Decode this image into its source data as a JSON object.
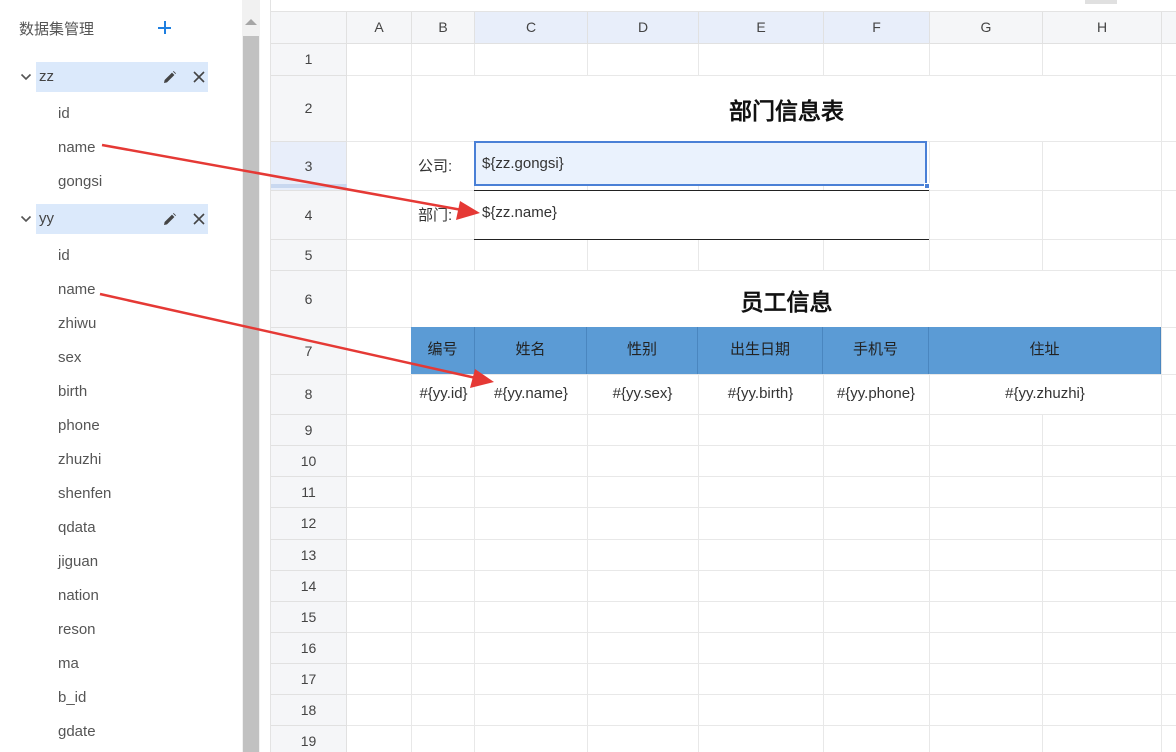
{
  "panel": {
    "title": "数据集管理",
    "datasets": [
      {
        "name": "zz",
        "fields": [
          "id",
          "name",
          "gongsi"
        ]
      },
      {
        "name": "yy",
        "fields": [
          "id",
          "name",
          "zhiwu",
          "sex",
          "birth",
          "phone",
          "zhuzhi",
          "shenfen",
          "qdata",
          "jiguan",
          "nation",
          "reson",
          "ma",
          "b_id",
          "gdate"
        ]
      }
    ]
  },
  "sheet": {
    "columns": [
      "A",
      "B",
      "C",
      "D",
      "E",
      "F",
      "G",
      "H"
    ],
    "rows": [
      "1",
      "2",
      "3",
      "4",
      "5",
      "6",
      "7",
      "8",
      "9",
      "10",
      "11",
      "12",
      "13",
      "14",
      "15",
      "16",
      "17",
      "18",
      "19"
    ],
    "title": "部门信息表",
    "company_label": "公司:",
    "company_value": "${zz.gongsi}",
    "dept_label": "部门:",
    "dept_value": "${zz.name}",
    "subtitle": "员工信息",
    "table_headers": [
      "编号",
      "姓名",
      "性别",
      "出生日期",
      "手机号",
      "住址"
    ],
    "table_row": [
      "#{yy.id}",
      "#{yy.name}",
      "#{yy.sex}",
      "#{yy.birth}",
      "#{yy.phone}",
      "#{yy.zhuzhi}"
    ]
  },
  "colors": {
    "accent": "#1e7fe0",
    "selection": "#dbe9fb",
    "table_header": "#5b9bd5",
    "arrow": "#e53935"
  }
}
